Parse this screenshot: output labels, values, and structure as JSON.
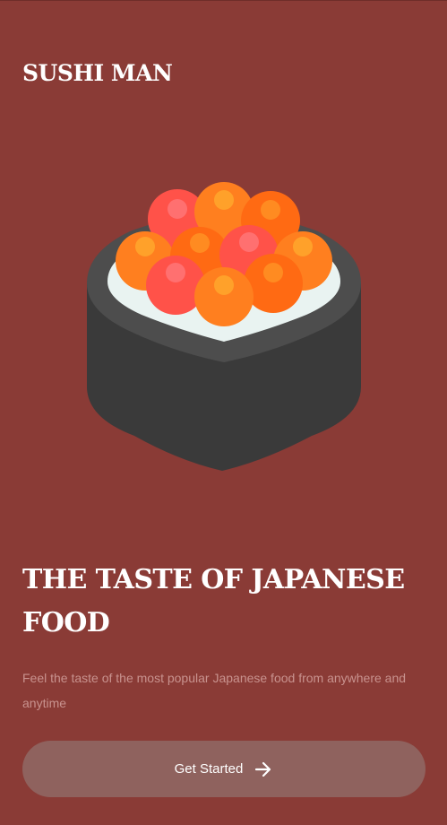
{
  "brand": {
    "title": "SUSHI MAN"
  },
  "hero": {
    "illustration_icon": "sushi-roll-roe-icon"
  },
  "headline": {
    "text": "THE TASTE OF JAPANESE FOOD"
  },
  "subtext": {
    "text": "Feel the taste of the most popular Japanese food from anywhere and anytime"
  },
  "cta": {
    "label": "Get Started",
    "icon": "arrow-right-icon"
  },
  "colors": {
    "background": "#8A3B36",
    "button": "#8F625E",
    "subtext": "#C8928E",
    "title": "#FFFFFF"
  }
}
